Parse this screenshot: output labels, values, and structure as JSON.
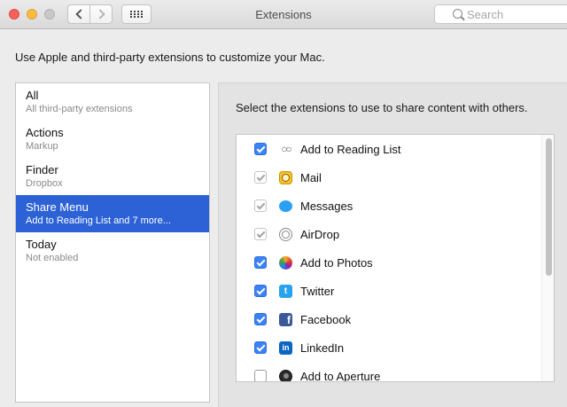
{
  "window": {
    "title": "Extensions",
    "search_placeholder": "Search"
  },
  "intro_text": "Use Apple and third-party extensions to customize your Mac.",
  "sidebar": {
    "selected_index": 3,
    "items": [
      {
        "label": "All",
        "sub": "All third-party extensions"
      },
      {
        "label": "Actions",
        "sub": "Markup"
      },
      {
        "label": "Finder",
        "sub": "Dropbox"
      },
      {
        "label": "Share Menu",
        "sub": "Add to Reading List and 7 more..."
      },
      {
        "label": "Today",
        "sub": "Not enabled"
      }
    ]
  },
  "panel": {
    "description": "Select the extensions to use to share content with others.",
    "extensions": [
      {
        "name": "Add to Reading List",
        "icon": "reading-list-icon",
        "checked": true,
        "enabled": true
      },
      {
        "name": "Mail",
        "icon": "mail-icon",
        "checked": true,
        "enabled": false
      },
      {
        "name": "Messages",
        "icon": "messages-icon",
        "checked": true,
        "enabled": false
      },
      {
        "name": "AirDrop",
        "icon": "airdrop-icon",
        "checked": true,
        "enabled": false
      },
      {
        "name": "Add to Photos",
        "icon": "photos-icon",
        "checked": true,
        "enabled": true
      },
      {
        "name": "Twitter",
        "icon": "twitter-icon",
        "checked": true,
        "enabled": true
      },
      {
        "name": "Facebook",
        "icon": "facebook-icon",
        "checked": true,
        "enabled": true
      },
      {
        "name": "LinkedIn",
        "icon": "linkedin-icon",
        "checked": true,
        "enabled": true
      },
      {
        "name": "Add to Aperture",
        "icon": "aperture-icon",
        "checked": false,
        "enabled": true
      }
    ]
  },
  "colors": {
    "selection": "#2d62d6",
    "checkbox_on": "#3b82f6"
  }
}
